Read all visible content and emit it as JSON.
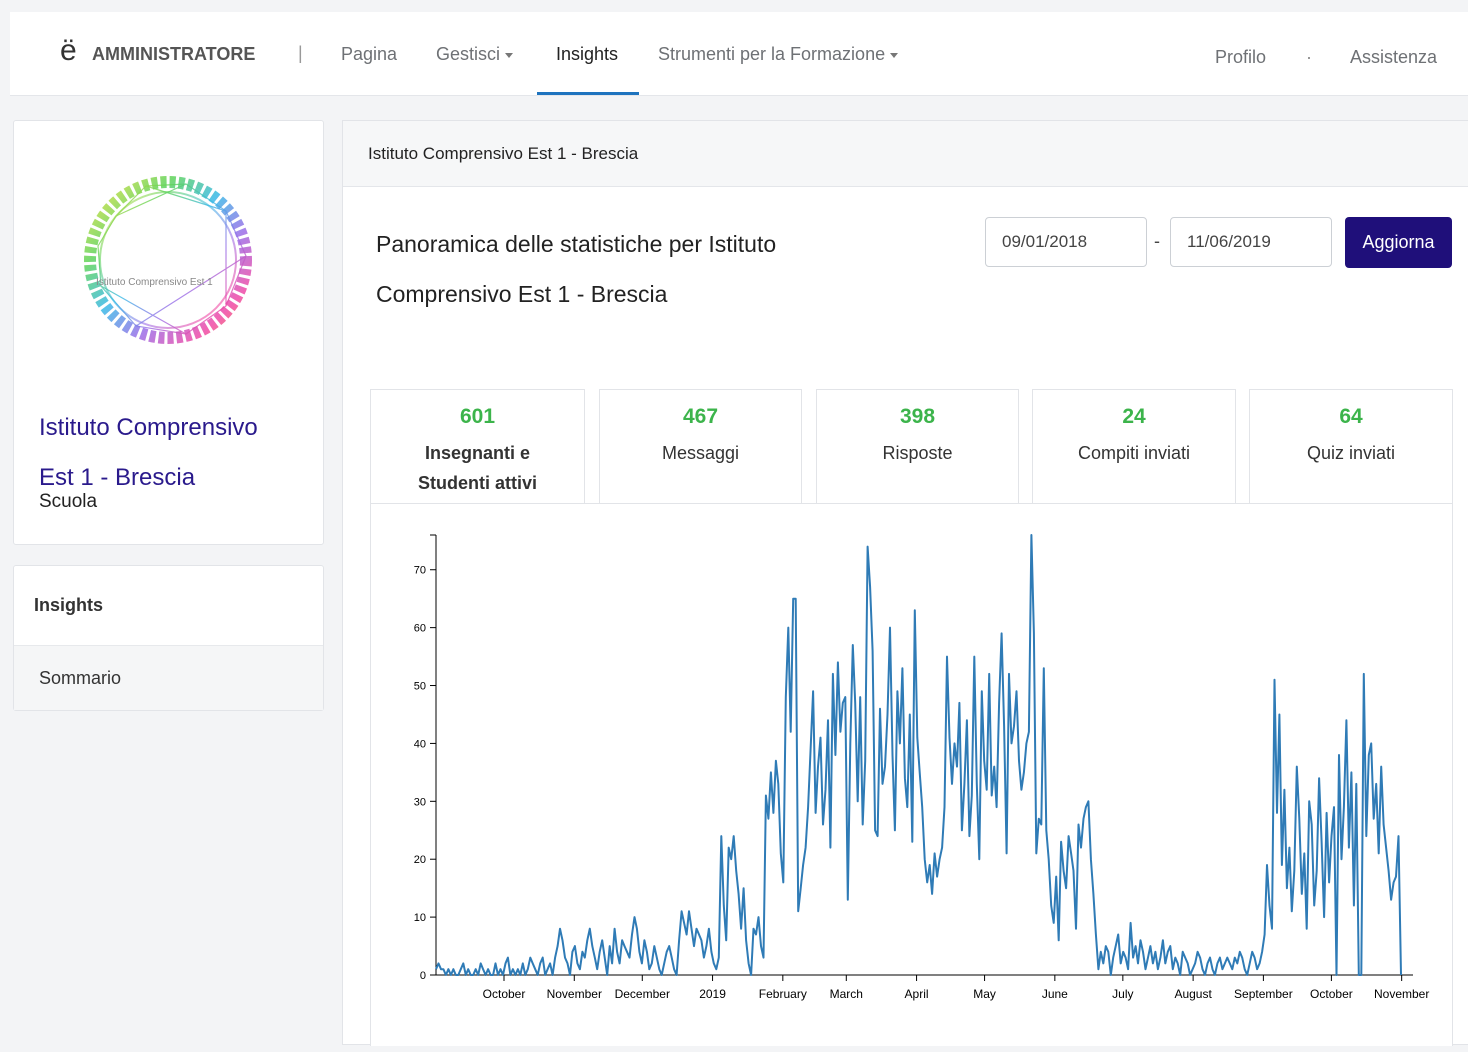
{
  "nav": {
    "logo_glyph": "ë",
    "brand": "AMMINISTRATORE",
    "separator": "|",
    "links": [
      "Pagina",
      "Gestisci",
      "Insights",
      "Strumenti per la Formazione"
    ],
    "active": "Insights",
    "right_links": [
      "Profilo",
      "Assistenza"
    ],
    "dot": "·"
  },
  "profile": {
    "logo_text": "Istituto Comprensivo Est 1",
    "name": "Istituto Comprensivo Est 1 - Brescia",
    "type": "Scuola"
  },
  "sidebar": {
    "header": "Insights",
    "items": [
      "Sommario"
    ]
  },
  "panel": {
    "header": "Istituto Comprensivo Est 1 - Brescia",
    "title": "Panoramica delle statistiche per Istituto Comprensivo Est 1 - Brescia",
    "date_from": "09/01/2018",
    "date_dash": "-",
    "date_to": "11/06/2019",
    "update_button": "Aggiorna"
  },
  "tabs": [
    {
      "value": "601",
      "label": "Insegnanti e Studenti attivi",
      "active": true
    },
    {
      "value": "467",
      "label": "Messaggi",
      "active": false
    },
    {
      "value": "398",
      "label": "Risposte",
      "active": false
    },
    {
      "value": "24",
      "label": "Compiti inviati",
      "active": false
    },
    {
      "value": "64",
      "label": "Quiz inviati",
      "active": false
    }
  ],
  "colors": {
    "brand": "#1f0f7a",
    "stat_value": "#3cb44b",
    "line": "#2f7bb6",
    "active_tab": "#1e73be"
  },
  "chart_data": {
    "type": "line",
    "x_start": "2018-09-01",
    "x_end": "2019-11-06",
    "x_ticks": [
      "October",
      "November",
      "December",
      "2019",
      "February",
      "March",
      "April",
      "May",
      "June",
      "July",
      "August",
      "September",
      "October",
      "November"
    ],
    "y_ticks": [
      0,
      10,
      20,
      30,
      40,
      50,
      60,
      70
    ],
    "ylim": [
      0,
      76
    ],
    "grid": false,
    "series": [
      {
        "values": [
          1,
          2,
          1,
          1,
          0,
          1,
          0,
          1,
          0,
          0,
          1,
          2,
          0,
          1,
          0,
          0,
          1,
          0,
          2,
          1,
          0,
          1,
          0,
          0,
          2,
          0,
          1,
          0,
          2,
          3,
          0,
          1,
          0,
          1,
          0,
          2,
          0,
          1,
          3,
          2,
          1,
          0,
          2,
          3,
          0,
          1,
          2,
          0,
          3,
          5,
          8,
          6,
          3,
          2,
          0,
          4,
          5,
          2,
          1,
          4,
          3,
          6,
          8,
          5,
          3,
          1,
          4,
          6,
          3,
          0,
          5,
          2,
          8,
          4,
          2,
          6,
          5,
          4,
          3,
          7,
          10,
          8,
          4,
          2,
          6,
          4,
          1,
          2,
          5,
          3,
          1,
          0,
          2,
          4,
          5,
          3,
          1,
          0,
          6,
          11,
          9,
          7,
          11,
          8,
          5,
          8,
          7,
          6,
          3,
          5,
          8,
          4,
          2,
          1,
          3,
          24,
          12,
          6,
          22,
          20,
          24,
          18,
          14,
          8,
          15,
          6,
          2,
          0,
          8,
          7,
          10,
          5,
          3,
          31,
          27,
          35,
          28,
          37,
          33,
          21,
          16,
          48,
          60,
          42,
          65,
          65,
          11,
          15,
          19,
          22,
          29,
          39,
          49,
          28,
          36,
          41,
          26,
          32,
          44,
          22,
          52,
          38,
          54,
          42,
          47,
          48,
          13,
          40,
          57,
          47,
          30,
          48,
          26,
          37,
          74,
          67,
          56,
          25,
          24,
          46,
          33,
          36,
          45,
          60,
          38,
          25,
          49,
          40,
          53,
          34,
          29,
          45,
          23,
          63,
          41,
          35,
          29,
          20,
          16,
          19,
          14,
          21,
          17,
          20,
          22,
          29,
          55,
          41,
          33,
          40,
          36,
          47,
          25,
          33,
          44,
          24,
          31,
          55,
          33,
          20,
          49,
          37,
          32,
          52,
          31,
          36,
          29,
          47,
          59,
          43,
          21,
          52,
          40,
          43,
          49,
          37,
          32,
          35,
          40,
          42,
          76,
          59,
          21,
          27,
          26,
          53,
          25,
          20,
          12,
          9,
          17,
          6,
          23,
          18,
          15,
          24,
          21,
          18,
          8,
          26,
          22,
          27,
          29,
          30,
          20,
          14,
          7,
          1,
          4,
          2,
          5,
          4,
          0,
          3,
          5,
          7,
          2,
          4,
          3,
          1,
          9,
          3,
          5,
          2,
          6,
          4,
          1,
          3,
          5,
          2,
          4,
          1,
          3,
          6,
          2,
          4,
          5,
          1,
          3,
          2,
          0,
          4,
          3,
          2,
          0,
          1,
          2,
          4,
          3,
          1,
          0,
          2,
          3,
          1,
          0,
          2,
          3,
          1,
          2,
          3,
          2,
          1,
          3,
          2,
          4,
          3,
          1,
          0,
          2,
          4,
          3,
          1,
          2,
          4,
          7,
          19,
          12,
          8,
          51,
          28,
          45,
          19,
          32,
          15,
          22,
          11,
          18,
          36,
          27,
          14,
          21,
          8,
          30,
          26,
          12,
          18,
          34,
          23,
          10,
          28,
          16,
          24,
          29,
          0,
          38,
          20,
          29,
          44,
          22,
          35,
          12,
          33,
          0,
          0,
          52,
          24,
          38,
          40,
          27,
          33,
          21,
          36,
          26,
          22,
          18,
          13,
          16,
          17,
          24,
          0
        ],
        "color": "#2f7bb6"
      }
    ]
  }
}
